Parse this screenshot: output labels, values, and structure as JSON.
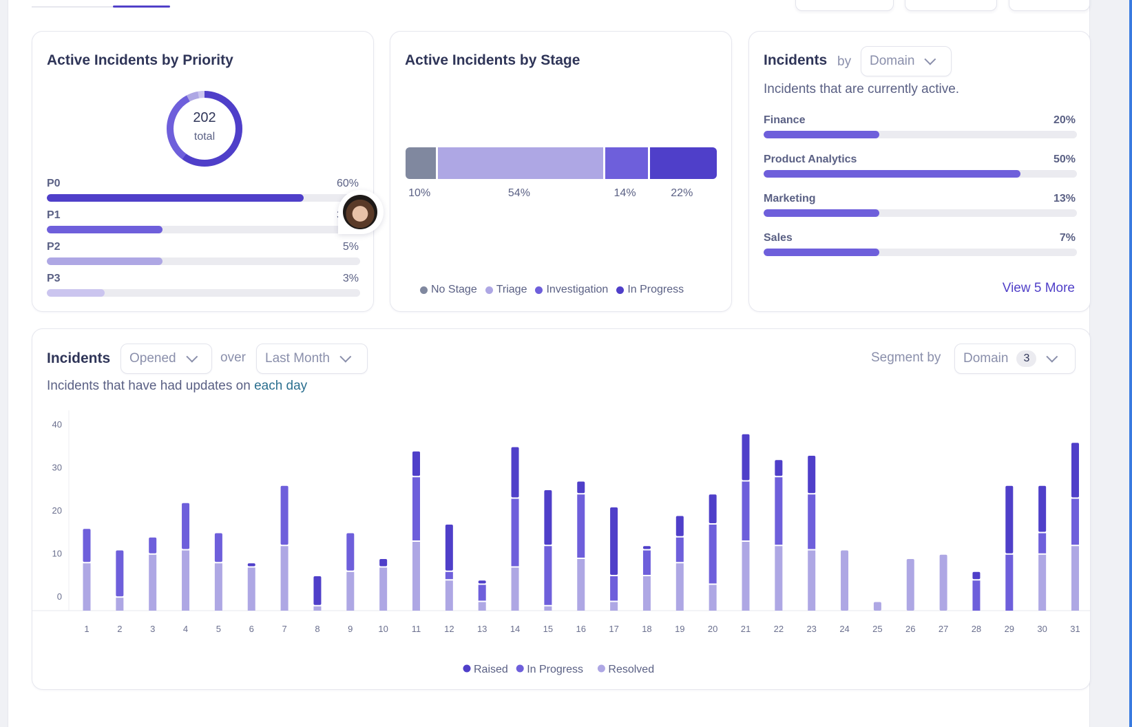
{
  "colors": {
    "raised": "#4f3fc9",
    "in_progress": "#6e5fdb",
    "resolved": "#aea7e4",
    "no_stage": "#80889f",
    "triage": "#aea7e4",
    "investigation": "#6e5fdb",
    "stage_in_progress": "#4f3fc9",
    "p0": "#4f3fc9",
    "p1": "#6e5fdb",
    "p2": "#aea7e4",
    "p3": "#cbc5ef",
    "domain_fill": "#6e5fdb",
    "track": "#ebebf0",
    "accent": "#5040c8"
  },
  "priority_card": {
    "title": "Active Incidents by Priority",
    "donut": {
      "total": "202",
      "label": "total"
    },
    "rows": [
      {
        "label": "P0",
        "value": "60%",
        "fill": 0.82
      },
      {
        "label": "P1",
        "value": "32%",
        "fill": 0.37
      },
      {
        "label": "P2",
        "value": "5%",
        "fill": 0.37
      },
      {
        "label": "P3",
        "value": "3%",
        "fill": 0.185
      }
    ]
  },
  "stage_card": {
    "title": "Active Incidents by Stage",
    "segments": [
      {
        "name": "No Stage",
        "pct": 10,
        "label": "10%"
      },
      {
        "name": "Triage",
        "pct": 54,
        "label": "54%"
      },
      {
        "name": "Investigation",
        "pct": 14,
        "label": "14%"
      },
      {
        "name": "In Progress",
        "pct": 22,
        "label": "22%"
      }
    ],
    "legend": [
      "No Stage",
      "Triage",
      "Investigation",
      "In Progress"
    ]
  },
  "domain_card": {
    "title": "Incidents",
    "by": "by",
    "select_value": "Domain",
    "subtitle": "Incidents that are currently active.",
    "rows": [
      {
        "label": "Finance",
        "value": "20%",
        "fill": 0.37
      },
      {
        "label": "Product Analytics",
        "value": "50%",
        "fill": 0.82
      },
      {
        "label": "Marketing",
        "value": "13%",
        "fill": 0.37
      },
      {
        "label": "Sales",
        "value": "7%",
        "fill": 0.37
      }
    ],
    "view_more": "View 5 More"
  },
  "incidents_chart_card": {
    "title": "Incidents",
    "metric_select": "Opened",
    "over": "over",
    "range_select": "Last Month",
    "segment_by_label": "Segment by",
    "segment_select": "Domain",
    "segment_count": "3",
    "subtitle_prefix": "Incidents that have had updates on ",
    "subtitle_link": "each day"
  },
  "chart_data": {
    "type": "bar",
    "stacked": true,
    "title": "Incidents",
    "xlabel": "",
    "ylabel": "",
    "ylim": [
      0,
      40
    ],
    "yticks": [
      0,
      10,
      20,
      30,
      40
    ],
    "categories": [
      "1",
      "2",
      "3",
      "4",
      "5",
      "6",
      "7",
      "8",
      "9",
      "10",
      "11",
      "12",
      "13",
      "14",
      "15",
      "16",
      "17",
      "18",
      "19",
      "20",
      "21",
      "22",
      "23",
      "24",
      "25",
      "26",
      "27",
      "28",
      "29",
      "30",
      "31"
    ],
    "series": [
      {
        "name": "Resolved",
        "values": [
          11,
          3,
          13,
          14,
          11,
          10,
          15,
          1,
          9,
          10,
          16,
          7,
          2,
          10,
          1,
          12,
          2,
          8,
          11,
          6,
          16,
          15,
          14,
          14,
          2,
          12,
          13,
          0,
          0,
          13,
          15
        ]
      },
      {
        "name": "In Progress",
        "values": [
          8,
          11,
          4,
          11,
          7,
          0,
          14,
          0,
          9,
          0,
          15,
          2,
          4,
          16,
          14,
          15,
          6,
          6,
          6,
          14,
          14,
          16,
          13,
          0,
          0,
          0,
          0,
          7,
          13,
          5,
          11
        ]
      },
      {
        "name": "Raised",
        "values": [
          0,
          0,
          0,
          0,
          0,
          1,
          0,
          7,
          0,
          2,
          6,
          11,
          1,
          12,
          13,
          3,
          16,
          1,
          5,
          7,
          11,
          4,
          9,
          0,
          0,
          0,
          0,
          2,
          16,
          11,
          13
        ]
      }
    ],
    "legend": [
      "Raised",
      "In Progress",
      "Resolved"
    ],
    "legend_position": "bottom-center",
    "grid": false
  }
}
